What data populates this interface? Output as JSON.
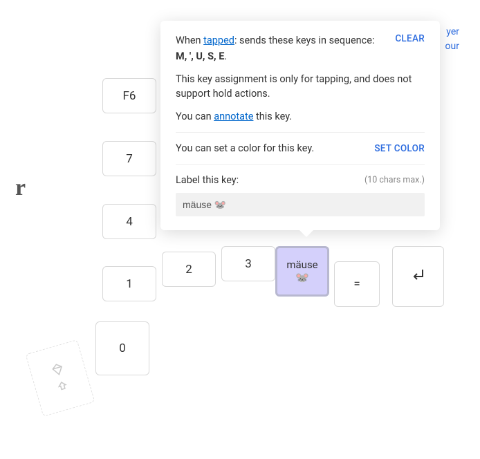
{
  "corner": {
    "line1": "yer",
    "line2": "our"
  },
  "sidebar_r": "r",
  "keys": {
    "f6": "F6",
    "k7": "7",
    "k4": "4",
    "k1": "1",
    "k2": "2",
    "k3": "3",
    "mause_label": "mäuse",
    "mause_emoji": "🐭",
    "eq": "=",
    "k0": "0"
  },
  "tooltip": {
    "when": "When ",
    "tapped_link": "tapped",
    "sends": ": sends these keys in sequence:",
    "sequence": "M, ', U, S, E",
    "period": ".",
    "clear": "CLEAR",
    "note": "This key assignment is only for tapping, and does not support hold actions.",
    "annotate_prefix": "You can ",
    "annotate_link": "annotate",
    "annotate_suffix": " this key.",
    "color_text": "You can set a color for this key.",
    "set_color": "SET COLOR",
    "label_text": "Label this key:",
    "label_hint": "(10 chars max.)",
    "label_value": "mäuse 🐭"
  }
}
